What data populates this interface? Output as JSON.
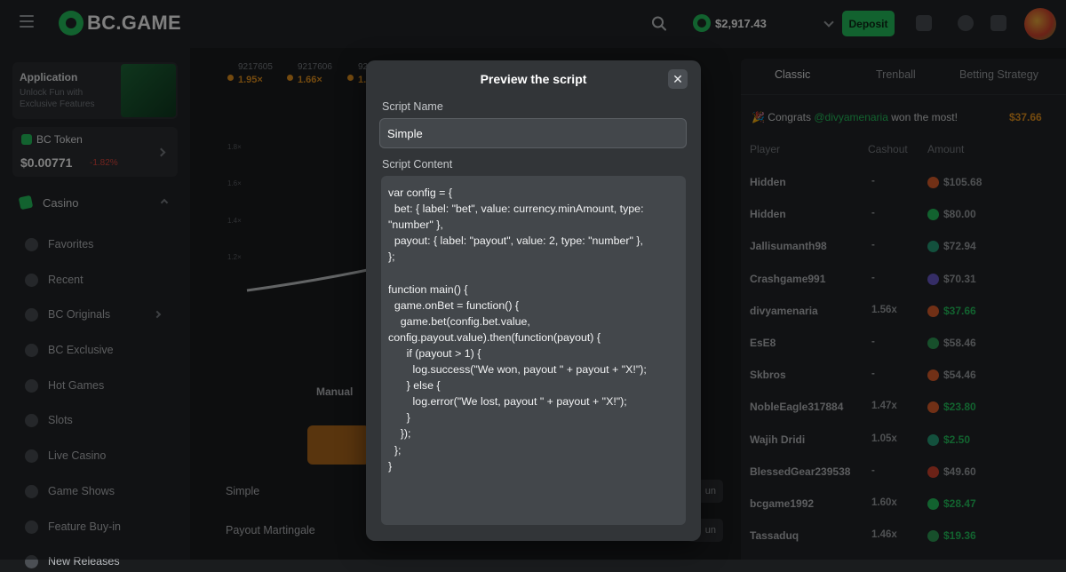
{
  "header": {
    "logo_text": "BC.GAME",
    "balance": "$2,917.43",
    "deposit_label": "Deposit"
  },
  "sidebar": {
    "app_card": {
      "title": "Application",
      "subtitle": "Unlock Fun with Exclusive Features"
    },
    "token": {
      "name": "BC Token",
      "price": "$0.00771",
      "change": "-1.82%"
    },
    "casino_label": "Casino",
    "items": [
      {
        "label": "Favorites",
        "icon": "star-icon"
      },
      {
        "label": "Recent",
        "icon": "clock-icon"
      },
      {
        "label": "BC Originals",
        "icon": "bc-icon"
      },
      {
        "label": "BC Exclusive",
        "icon": "gamepad-icon"
      },
      {
        "label": "Hot Games",
        "icon": "fire-icon"
      },
      {
        "label": "Slots",
        "icon": "slots-icon"
      },
      {
        "label": "Live Casino",
        "icon": "live-icon"
      },
      {
        "label": "Game Shows",
        "icon": "pacman-icon"
      },
      {
        "label": "Feature Buy-in",
        "icon": "star-badge-icon"
      },
      {
        "label": "New Releases",
        "icon": "new-icon"
      }
    ]
  },
  "game": {
    "history": [
      {
        "id": "9217605",
        "multiplier": "1.95×"
      },
      {
        "id": "9217606",
        "multiplier": "1.66×"
      },
      {
        "id": "92",
        "multiplier": "1."
      }
    ],
    "chart_ticks": [
      "1.8×",
      "1.6×",
      "1.4×",
      "1.2×"
    ],
    "manual_tab": "Manual",
    "script_rows": [
      {
        "label": "Simple",
        "action": "un"
      },
      {
        "label": "Payout Martingale",
        "action": "un"
      }
    ]
  },
  "right_panel": {
    "tabs": [
      "Classic",
      "Trenball",
      "Betting Strategy"
    ],
    "congrats": {
      "prefix": "Congrats",
      "user": "@divyamenaria",
      "suffix": "won the most!",
      "amount": "$37.66"
    },
    "columns": [
      "Player",
      "Cashout",
      "Amount"
    ],
    "rows": [
      {
        "player": "Hidden",
        "cashout": "-",
        "amount": "$105.68",
        "coin": "#e2612c",
        "win": false
      },
      {
        "player": "Hidden",
        "cashout": "-",
        "amount": "$80.00",
        "coin": "#24c45e",
        "win": false
      },
      {
        "player": "Jallisumanth98",
        "cashout": "-",
        "amount": "$72.94",
        "coin": "#26a17b",
        "win": false
      },
      {
        "player": "Crashgame991",
        "cashout": "-",
        "amount": "$70.31",
        "coin": "#6a5acd",
        "win": false
      },
      {
        "player": "divyamenaria",
        "cashout": "1.56x",
        "amount": "$37.66",
        "coin": "#e2612c",
        "win": true
      },
      {
        "player": "EsE8",
        "cashout": "-",
        "amount": "$58.46",
        "coin": "#2e9e57",
        "win": false
      },
      {
        "player": "Skbros",
        "cashout": "-",
        "amount": "$54.46",
        "coin": "#e2612c",
        "win": false
      },
      {
        "player": "NobleEagle317884",
        "cashout": "1.47x",
        "amount": "$23.80",
        "coin": "#e2612c",
        "win": true
      },
      {
        "player": "Wajih Dridi",
        "cashout": "1.05x",
        "amount": "$2.50",
        "coin": "#26a17b",
        "win": true
      },
      {
        "player": "BlessedGear239538",
        "cashout": "-",
        "amount": "$49.60",
        "coin": "#d6442e",
        "win": false
      },
      {
        "player": "bcgame1992",
        "cashout": "1.60x",
        "amount": "$28.47",
        "coin": "#24c45e",
        "win": true
      },
      {
        "player": "Tassaduq",
        "cashout": "1.46x",
        "amount": "$19.36",
        "coin": "#2e9e57",
        "win": true
      }
    ]
  },
  "modal": {
    "title": "Preview the script",
    "close_label": "✕",
    "name_label": "Script Name",
    "name_value": "Simple",
    "content_label": "Script Content",
    "content": "var config = {\n  bet: { label: \"bet\", value: currency.minAmount, type: \"number\" },\n  payout: { label: \"payout\", value: 2, type: \"number\" },\n};\n\nfunction main() {\n  game.onBet = function() {\n    game.bet(config.bet.value, config.payout.value).then(function(payout) {\n      if (payout > 1) {\n        log.success(\"We won, payout \" + payout + \"X!\");\n      } else {\n        log.error(\"We lost, payout \" + payout + \"X!\");\n      }\n    });\n  };\n}"
  }
}
